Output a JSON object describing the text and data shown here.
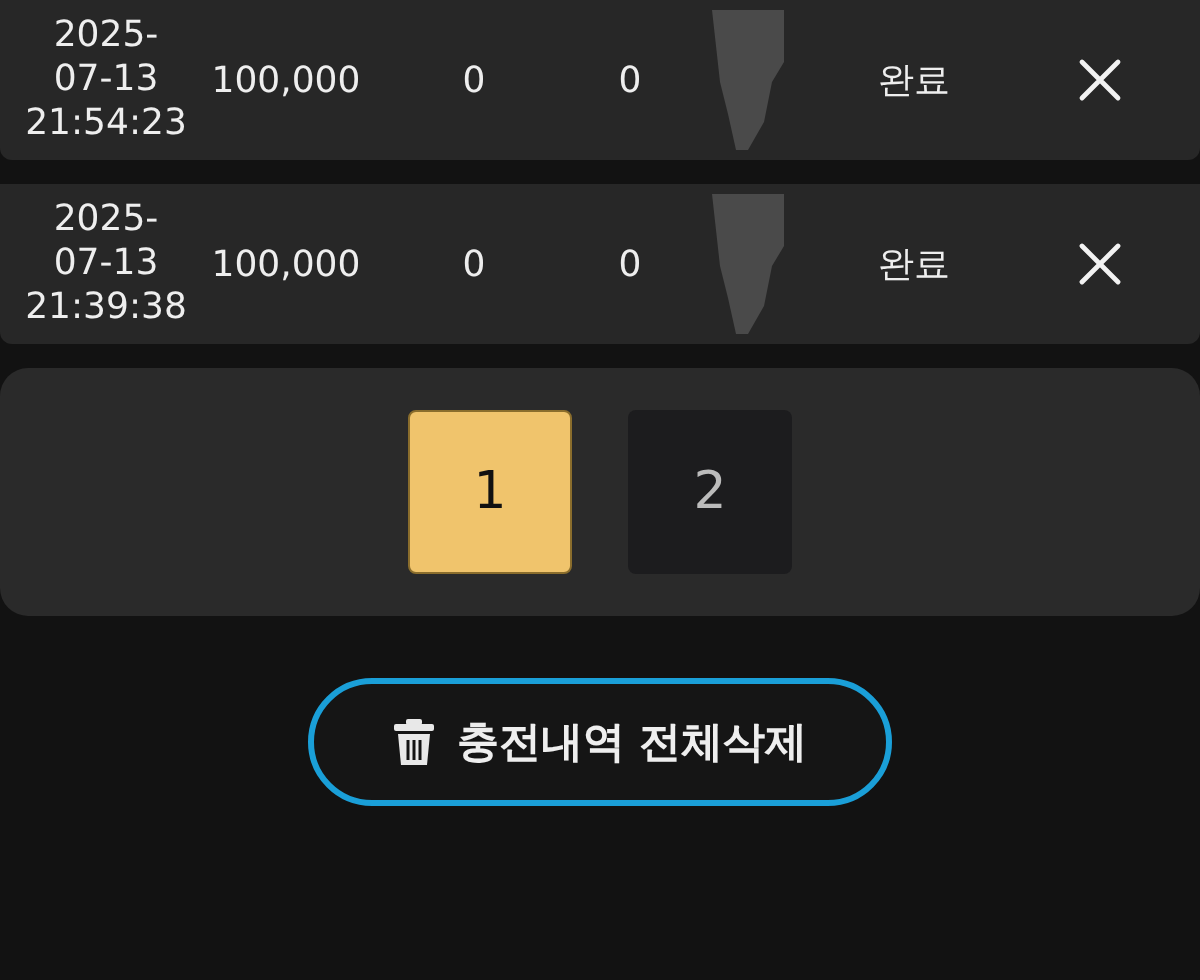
{
  "table": {
    "rows": [
      {
        "date": "2025-\n07-13\n21:54:23",
        "amount": "100,000",
        "column_3": "0",
        "column_4": "0",
        "status": "완료"
      },
      {
        "date": "2025-\n07-13\n21:39:38",
        "amount": "100,000",
        "column_3": "0",
        "column_4": "0",
        "status": "완료"
      }
    ]
  },
  "pagination": {
    "pages": [
      {
        "label": "1",
        "selected": true
      },
      {
        "label": "2",
        "selected": false
      }
    ]
  },
  "delete_all_button": {
    "label": "충전내역 전체삭제"
  }
}
